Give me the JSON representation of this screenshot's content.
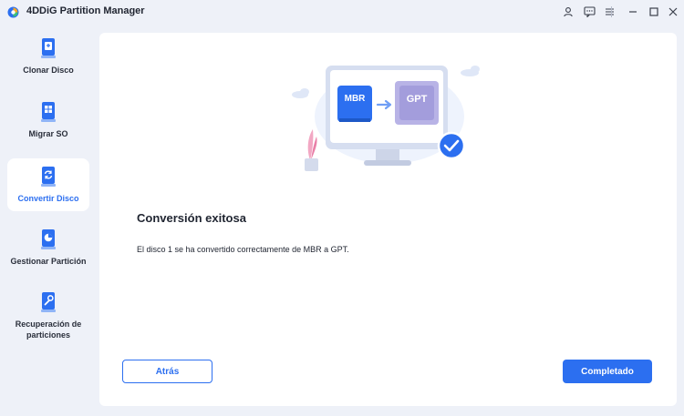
{
  "window": {
    "title": "4DDiG Partition Manager"
  },
  "titlebar_icons": [
    "user-icon",
    "feedback-icon",
    "menu-icon",
    "minimize-icon",
    "maximize-icon",
    "close-icon"
  ],
  "sidebar": {
    "items": [
      {
        "label": "Clonar Disco",
        "icon": "clone-disk-icon",
        "active": false
      },
      {
        "label": "Migrar SO",
        "icon": "migrate-os-icon",
        "active": false
      },
      {
        "label": "Convertir Disco",
        "icon": "convert-disk-icon",
        "active": true
      },
      {
        "label": "Gestionar Partición",
        "icon": "manage-partition-icon",
        "active": false
      },
      {
        "label": "Recuperación de particiones",
        "icon": "partition-recovery-icon",
        "active": false
      }
    ]
  },
  "main": {
    "illustration": {
      "from_label": "MBR",
      "to_label": "GPT"
    },
    "heading": "Conversión exitosa",
    "message": "El disco 1 se ha convertido correctamente de MBR a GPT.",
    "back_label": "Atrás",
    "done_label": "Completado"
  },
  "colors": {
    "accent": "#2c6ff0",
    "background": "#eef1f8",
    "panel": "#ffffff"
  }
}
